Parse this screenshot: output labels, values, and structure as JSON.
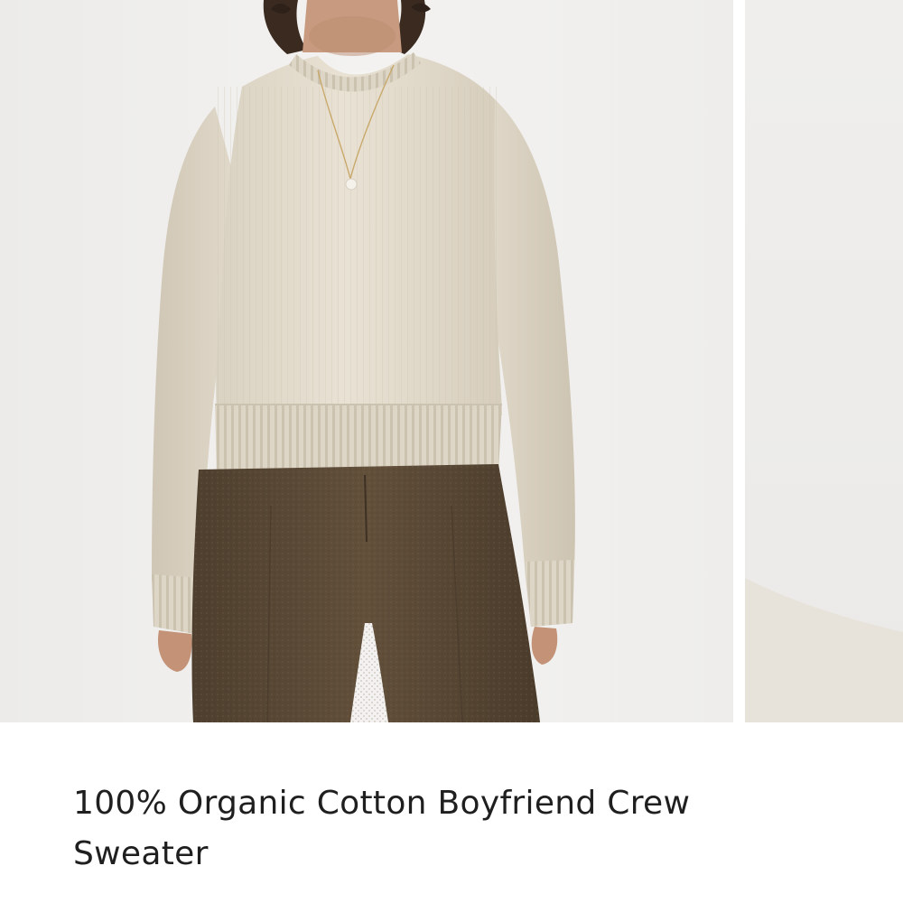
{
  "product": {
    "title": "100% Organic Cotton Boyfriend Crew Sweater"
  },
  "gallery": {
    "images": [
      {
        "name": "product-photo-model-front",
        "icon": "photo-icon"
      },
      {
        "name": "product-photo-next-peek",
        "icon": "photo-icon"
      }
    ]
  },
  "colors": {
    "background": "#ffffff",
    "photo_backdrop": "#f1f0ee",
    "sweater": "#e4dccd",
    "trousers": "#5b4a36",
    "title_text": "#1f1f1f"
  }
}
